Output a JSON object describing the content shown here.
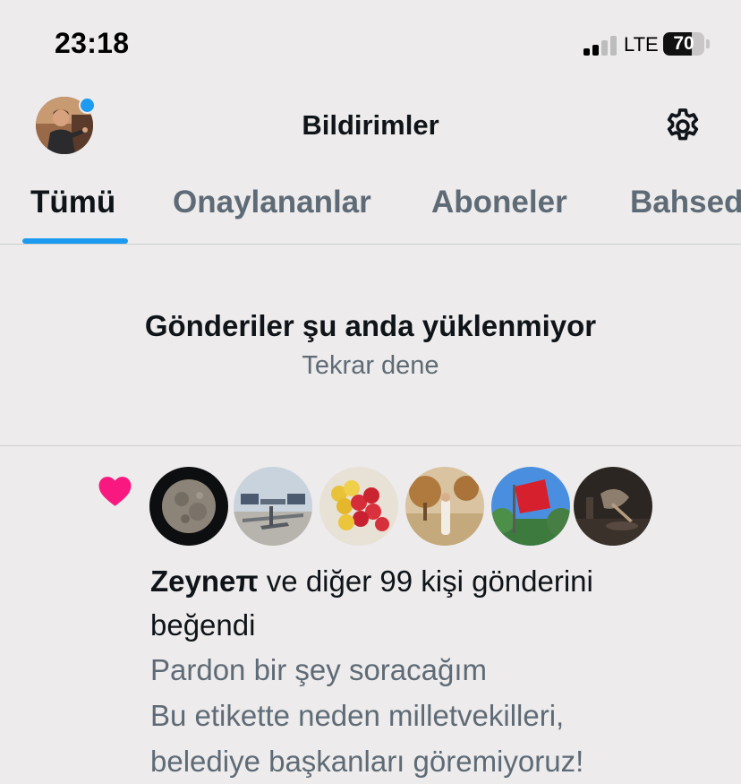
{
  "status_bar": {
    "time": "23:18",
    "network": "LTE",
    "battery_percent": 70,
    "battery_label": "70",
    "signal_bars_active": 2,
    "signal_bars_total": 4
  },
  "header": {
    "title": "Bildirimler",
    "avatar_icon": "profile-avatar",
    "settings_icon": "gear-icon"
  },
  "tabs": [
    {
      "label": "Tümü",
      "active": true
    },
    {
      "label": "Onaylananlar",
      "active": false
    },
    {
      "label": "Aboneler",
      "active": false
    },
    {
      "label": "Bahsedenler",
      "active": false
    }
  ],
  "error": {
    "title": "Gönderiler şu anda yüklenmiyor",
    "retry": "Tekrar dene"
  },
  "notification": {
    "icon": "heart-icon",
    "likers": [
      "moon",
      "drones",
      "apples",
      "landscape",
      "flag",
      "dark-still-life"
    ],
    "name": "Zeyneπ",
    "rest_line1": " ve diğer 99 kişi gönderini",
    "rest_line2": "beğendi",
    "tweet_lines": [
      "Pardon bir şey soracağım",
      "Bu etikette neden milletvekilleri,",
      "belediye başkanları göremiyoruz!"
    ]
  },
  "colors": {
    "accent": "#1D9BF0",
    "heart": "#F91880",
    "background": "#EDEBEB",
    "secondary_text": "#5E6B76"
  }
}
